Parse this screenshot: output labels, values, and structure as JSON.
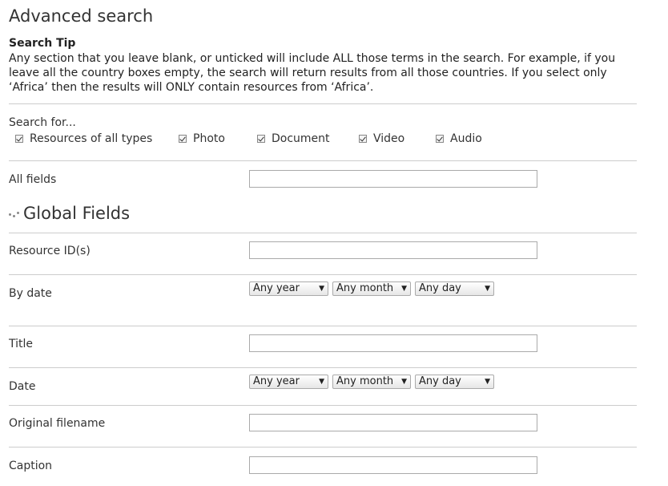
{
  "page": {
    "title": "Advanced search",
    "tip_title": "Search Tip",
    "tip_text": "Any section that you leave blank, or unticked will include ALL those terms in the search. For example, if you leave all the country boxes empty, the search will return results from all those countries. If you select only ‘Africa’ then the results will ONLY contain resources from ‘Africa’."
  },
  "search_for": {
    "label": "Search for...",
    "types": [
      {
        "label": "Resources of all types",
        "checked": true
      },
      {
        "label": "Photo",
        "checked": true
      },
      {
        "label": "Document",
        "checked": true
      },
      {
        "label": "Video",
        "checked": true
      },
      {
        "label": "Audio",
        "checked": true
      }
    ]
  },
  "all_fields": {
    "label": "All fields",
    "value": ""
  },
  "global_fields": {
    "heading": "Global Fields",
    "resource_id": {
      "label": "Resource ID(s)",
      "value": ""
    },
    "by_date": {
      "label": "By date",
      "year": "Any year",
      "month": "Any month",
      "day": "Any day"
    },
    "title": {
      "label": "Title",
      "value": ""
    },
    "date": {
      "label": "Date",
      "year": "Any year",
      "month": "Any month",
      "day": "Any day"
    },
    "original_filename": {
      "label": "Original filename",
      "value": ""
    },
    "caption": {
      "label": "Caption",
      "value": ""
    }
  },
  "icons": {
    "dropdown_arrow": "triangle-down",
    "section_bullet": "dots-icon"
  }
}
